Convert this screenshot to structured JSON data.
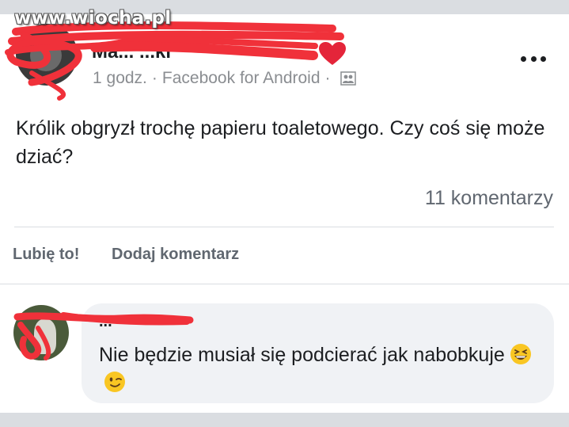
{
  "watermark": "www.wiocha.pl",
  "post": {
    "author": "Ma... ...ki",
    "time": "1 godz.",
    "separator": "·",
    "source": "Facebook for Android",
    "audience_icon": "friends-icon",
    "text": "Królik obgryzł trochę papieru toaletowego. Czy coś się może dziać?",
    "comments_count": "11 komentarzy"
  },
  "actions": {
    "like_label": "Lubię to!",
    "comment_label": "Dodaj komentarz"
  },
  "comment": {
    "author": "...",
    "text": "Nie będzie musiał się podcierać jak nabobkuje"
  },
  "colors": {
    "heart": "#e4253a",
    "scribble": "#f0313a",
    "emoji": "#f9c623"
  }
}
